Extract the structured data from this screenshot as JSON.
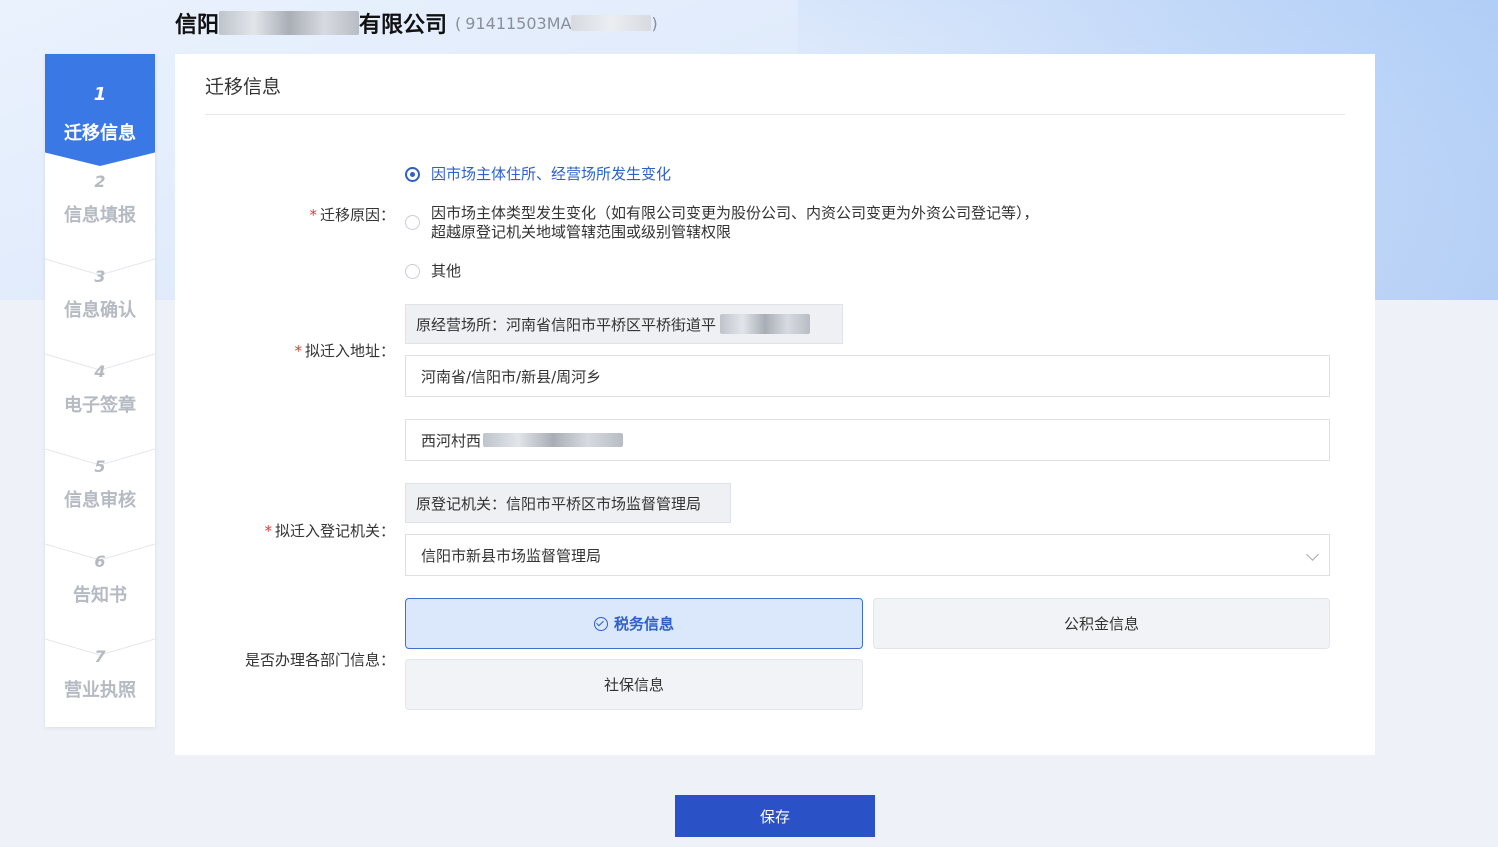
{
  "header": {
    "company_name_start": "信阳",
    "company_name_end": "有限公司",
    "credit_code_open": "(",
    "credit_code_visible": "91411503MA",
    "credit_code_close": ")"
  },
  "stepper": {
    "steps": [
      {
        "num": "1",
        "label": "迁移信息"
      },
      {
        "num": "2",
        "label": "信息填报"
      },
      {
        "num": "3",
        "label": "信息确认"
      },
      {
        "num": "4",
        "label": "电子签章"
      },
      {
        "num": "5",
        "label": "信息审核"
      },
      {
        "num": "6",
        "label": "告知书"
      },
      {
        "num": "7",
        "label": "营业执照"
      }
    ],
    "active_index": 0
  },
  "card": {
    "title": "迁移信息"
  },
  "form": {
    "reason": {
      "label": "迁移原因：",
      "options": [
        {
          "line1": "因市场主体住所、经营场所发生变化",
          "line2": "",
          "checked": true
        },
        {
          "line1": "因市场主体类型发生变化（如有限公司变更为股份公司、内资公司变更为外资公司登记等），",
          "line2": "超越原登记机关地域管辖范围或级别管辖权限",
          "checked": false
        },
        {
          "line1": "其他",
          "line2": "",
          "checked": false
        }
      ]
    },
    "address": {
      "label": "拟迁入地址：",
      "original": "原经营场所：河南省信阳市平桥区平桥街道平",
      "region_value": "河南省/信阳市/新县/周河乡",
      "detail_value": "西河村西"
    },
    "authority": {
      "label": "拟迁入登记机关：",
      "original": "原登记机关：信阳市平桥区市场监督管理局",
      "selected": "信阳市新县市场监督管理局"
    },
    "departments": {
      "label": "是否办理各部门信息：",
      "tax": "税务信息",
      "fund": "公积金信息",
      "social": "社保信息"
    }
  },
  "actions": {
    "save": "保存"
  }
}
